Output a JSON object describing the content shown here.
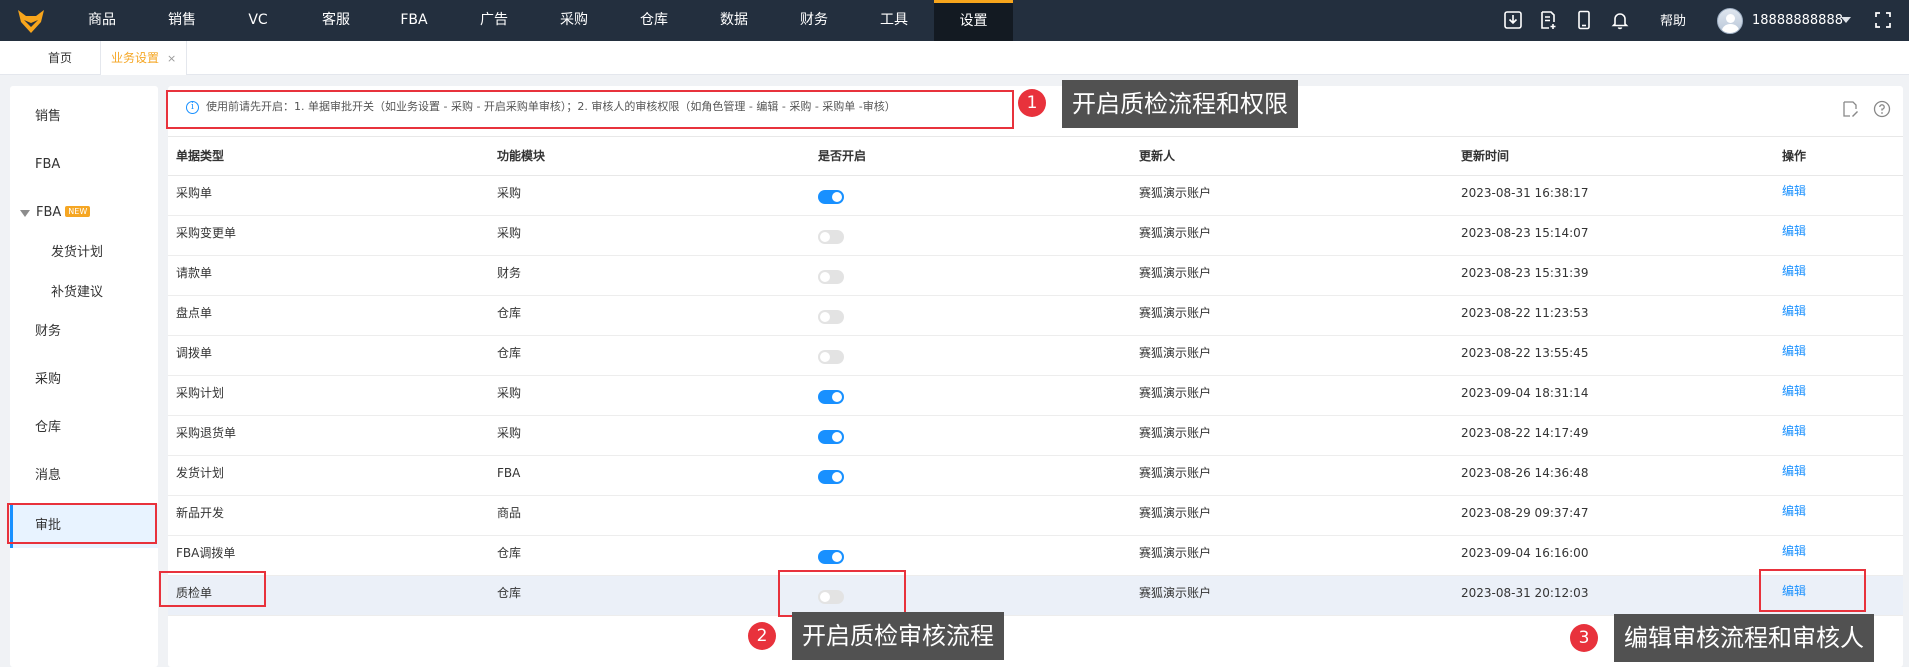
{
  "topnav": {
    "items": [
      "商品",
      "销售",
      "VC",
      "客服",
      "FBA",
      "广告",
      "采购",
      "仓库",
      "数据",
      "财务",
      "工具",
      "设置"
    ],
    "active": "设置",
    "help_label": "帮助",
    "user_name": "18888888888",
    "icons": [
      "download-icon",
      "export-list-icon",
      "mobile-icon",
      "bell-icon",
      "fullscreen-icon"
    ]
  },
  "tabs": {
    "home": "首页",
    "current": "业务设置",
    "close": "×"
  },
  "sidebar": {
    "items": [
      {
        "label": "销售"
      },
      {
        "label": "FBA"
      },
      {
        "label": "FBA",
        "badge": "NEW"
      },
      {
        "label": "发货计划"
      },
      {
        "label": "补货建议"
      },
      {
        "label": "财务"
      },
      {
        "label": "采购"
      },
      {
        "label": "仓库"
      },
      {
        "label": "消息"
      },
      {
        "label": "审批"
      }
    ],
    "active": "审批"
  },
  "notice": {
    "icon": "i",
    "text": "使用前请先开启：1. 单据审批开关（如业务设置 - 采购 - 开启采购单审核）；2. 审核人的审核权限（如角色管理 - 编辑 - 采购 - 采购单 -审核）"
  },
  "table": {
    "headers": [
      "单据类型",
      "功能模块",
      "是否开启",
      "更新人",
      "更新时间",
      "操作"
    ],
    "rows": [
      {
        "type": "采购单",
        "module": "采购",
        "enabled": true,
        "updater": "赛狐演示账户",
        "time": "2023-08-31 16:38:17",
        "action": "编辑"
      },
      {
        "type": "采购变更单",
        "module": "采购",
        "enabled": false,
        "updater": "赛狐演示账户",
        "time": "2023-08-23 15:14:07",
        "action": "编辑"
      },
      {
        "type": "请款单",
        "module": "财务",
        "enabled": false,
        "updater": "赛狐演示账户",
        "time": "2023-08-23 15:31:39",
        "action": "编辑"
      },
      {
        "type": "盘点单",
        "module": "仓库",
        "enabled": false,
        "updater": "赛狐演示账户",
        "time": "2023-08-22 11:23:53",
        "action": "编辑"
      },
      {
        "type": "调拨单",
        "module": "仓库",
        "enabled": false,
        "updater": "赛狐演示账户",
        "time": "2023-08-22 13:55:45",
        "action": "编辑"
      },
      {
        "type": "采购计划",
        "module": "采购",
        "enabled": true,
        "updater": "赛狐演示账户",
        "time": "2023-09-04 18:31:14",
        "action": "编辑"
      },
      {
        "type": "采购退货单",
        "module": "采购",
        "enabled": true,
        "updater": "赛狐演示账户",
        "time": "2023-08-22 14:17:49",
        "action": "编辑"
      },
      {
        "type": "发货计划",
        "module": "FBA",
        "enabled": true,
        "updater": "赛狐演示账户",
        "time": "2023-08-26 14:36:48",
        "action": "编辑"
      },
      {
        "type": "新品开发",
        "module": "商品",
        "enabled": null,
        "updater": "赛狐演示账户",
        "time": "2023-08-29 09:37:47",
        "action": "编辑"
      },
      {
        "type": "FBA调拨单",
        "module": "仓库",
        "enabled": true,
        "updater": "赛狐演示账户",
        "time": "2023-09-04 16:16:00",
        "action": "编辑"
      },
      {
        "type": "质检单",
        "module": "仓库",
        "enabled": false,
        "updater": "赛狐演示账户",
        "time": "2023-08-31 20:12:03",
        "action": "编辑"
      }
    ]
  },
  "callouts": [
    {
      "number": "1",
      "text": "开启质检流程和权限"
    },
    {
      "number": "2",
      "text": "开启质检审核流程"
    },
    {
      "number": "3",
      "text": "编辑审核流程和审核人"
    }
  ],
  "colors": {
    "accent": "#1890ff",
    "topbar": "#232f3e",
    "highlight": "#f5a623",
    "annotation": "#e8323c"
  }
}
